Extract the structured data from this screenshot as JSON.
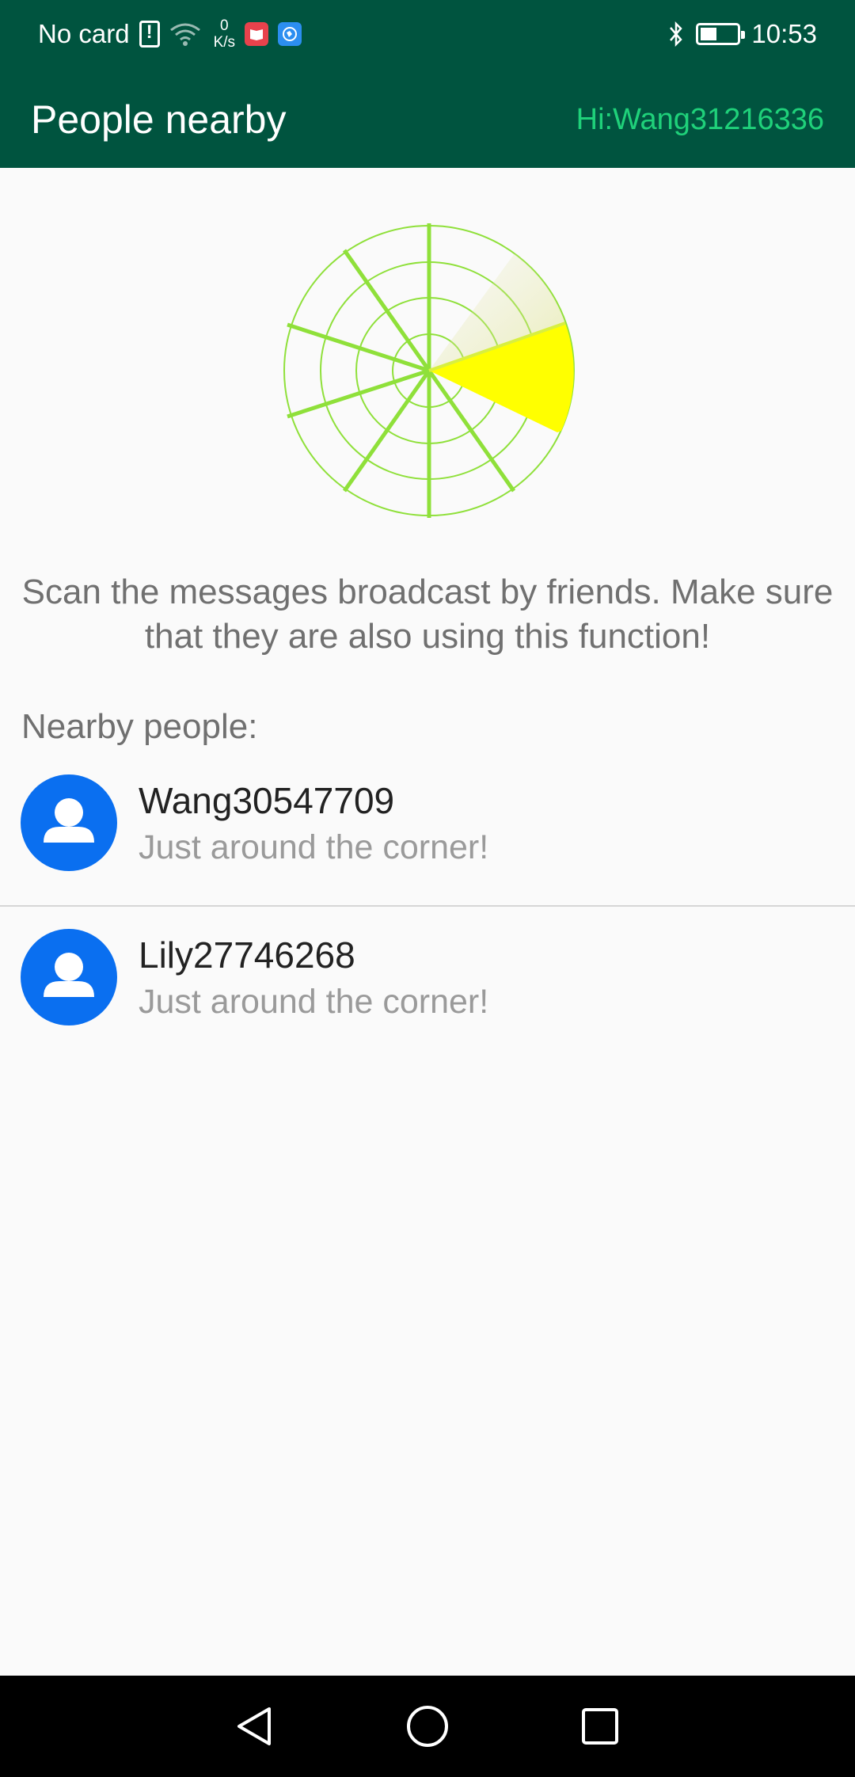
{
  "status_bar": {
    "carrier": "No card",
    "net_speed_value": "0",
    "net_speed_unit": "K/s",
    "time": "10:53",
    "battery_level": 0.4
  },
  "app_bar": {
    "title": "People nearby",
    "greeting": "Hi:Wang31216336"
  },
  "description": "Scan the messages broadcast by friends. Make sure that they are also using this function!",
  "nearby_label": "Nearby people:",
  "people": [
    {
      "name": "Wang30547709",
      "status": "Just around the corner!"
    },
    {
      "name": "Lily27746268",
      "status": "Just around the corner!"
    }
  ],
  "colors": {
    "bar": "#00543f",
    "greeting": "#1fd17a",
    "radar_line": "#8fe03a",
    "radar_sweep": "#ffff00",
    "avatar": "#0a6ff0"
  },
  "icons": {
    "status": [
      "sim-alert-icon",
      "wifi-icon",
      "book-app-icon",
      "browser-app-icon",
      "bluetooth-icon",
      "battery-charging-icon"
    ],
    "nav": [
      "back-icon",
      "home-icon",
      "recents-icon"
    ],
    "avatar": "person-icon"
  }
}
